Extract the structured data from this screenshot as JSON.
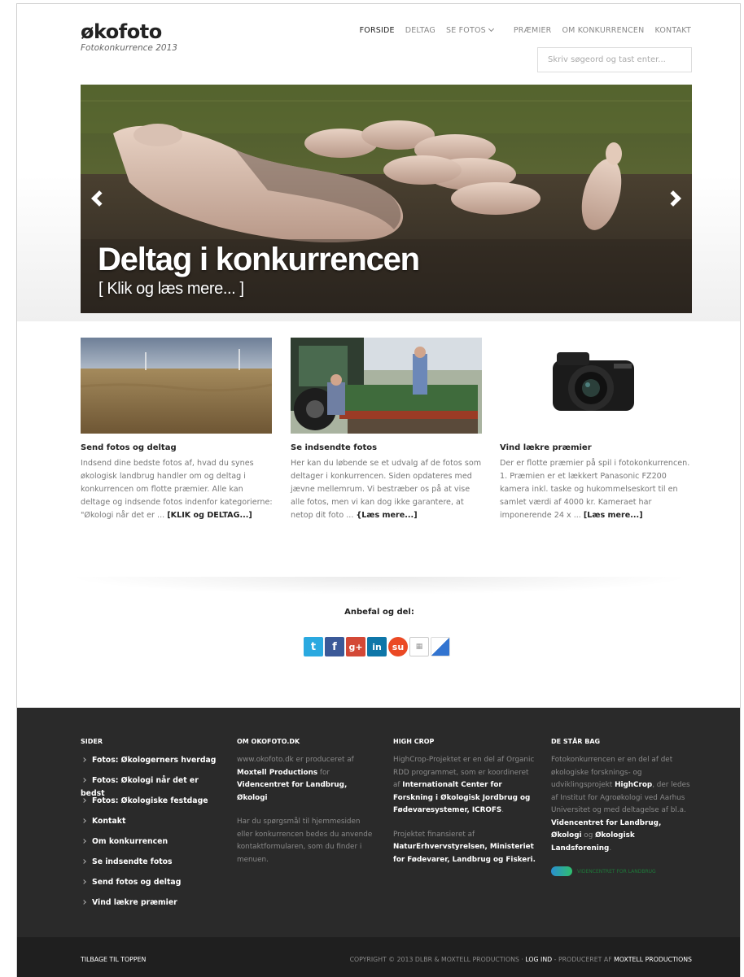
{
  "header": {
    "logo": "økofoto",
    "tagline": "Fotokonkurrence 2013",
    "nav": [
      "FORSIDE",
      "DELTAG",
      "SE FOTOS",
      "PRÆMIER",
      "OM KONKURRENCEN",
      "KONTAKT"
    ],
    "search_placeholder": "Skriv søgeord og tast enter..."
  },
  "hero": {
    "title": "Deltag i konkurrencen",
    "subtitle": "[ Klik og læs mere... ]"
  },
  "features": [
    {
      "title": "Send fotos og deltag",
      "text": "Indsend dine bedste fotos af, hvad du synes økologisk landbrug handler om og deltag i konkurrencen om flotte præmier. Alle kan deltage og indsende fotos indenfor kategorierne: \"Økologi når det er ...",
      "more": "[KLIK og DELTAG...]"
    },
    {
      "title": "Se indsendte fotos",
      "text": "Her kan du løbende se et udvalg af de fotos som deltager i konkurrencen. Siden opdateres med jævne mellemrum. Vi bestræber os på at vise alle fotos, men vi kan  dog ikke garantere, at netop dit foto ...",
      "more": "{Læs mere...]"
    },
    {
      "title": "Vind lækre præmier",
      "text": "Der er flotte præmier på spil i fotokonkurrencen. 1. Præmien er et lækkert Panasonic FZ200 kamera inkl. taske og hukommelseskort til en samlet værdi af 4000 kr. Kameraet har imponerende 24 x ...",
      "more": "[Læs mere...]"
    }
  ],
  "share": {
    "title": "Anbefal og del:",
    "icons": [
      "twitter-icon",
      "facebook-icon",
      "google-plus-icon",
      "linkedin-icon",
      "stumbleupon-icon",
      "digg-icon",
      "delicious-icon"
    ]
  },
  "footer": {
    "sider": {
      "title": "SIDER",
      "items": [
        "Fotos: Økologerners hverdag",
        "Fotos: Økologi når det er bedst",
        "Fotos: Økologiske festdage",
        "Kontakt",
        "Om konkurrencen",
        "Se indsendte fotos",
        "Send fotos og deltag",
        "Vind lækre præmier"
      ]
    },
    "om": {
      "title": "OM OKOFOTO.DK",
      "p1_a": "www.okofoto.dk er produceret af ",
      "p1_b": "Moxtell Productions",
      "p1_c": " for ",
      "p1_d": "Videncentret for Landbrug, Økologi",
      "p2": "Har du spørgsmål til hjemmesiden eller konkurrencen bedes du anvende kontaktformularen, som du finder i menuen."
    },
    "highcrop": {
      "title": "HIGH CROP",
      "p1_a": "HighCrop-Projektet er en del af Organic RDD programmet, som er koordineret af ",
      "p1_b": "Internationalt Center for Forskning i Økologisk Jordbrug og Fødevaresystemer, ICROFS",
      "p1_c": ".",
      "p2_a": "Projektet finansieret af ",
      "p2_b": "NaturErhvervstyrelsen, Ministeriet for Fødevarer, Landbrug og Fiskeri."
    },
    "bag": {
      "title": "DE STÅR BAG",
      "p_a": "Fotokonkurrencen er en del af det økologiske forsknings- og udviklingsprojekt ",
      "p_b": "HighCrop",
      "p_c": ", der ledes af Institut for Agroøkologi ved Aarhus Universitet og med deltagelse af bl.a. ",
      "p_d": "Videncentret for Landbrug, Økologi",
      "p_e": " og ",
      "p_f": "Økologisk Landsforening",
      "p_g": ".",
      "logo_text": "VIDENCENTRET FOR LANDBRUG"
    },
    "bottom_left": "TILBAGE TIL TOPPEN",
    "bottom_right_a": "COPYRIGHT © 2013 DLBR & MOXTELL PRODUCTIONS · ",
    "bottom_right_b": "LOG IND",
    "bottom_right_c": " - PRODUCERET AF ",
    "bottom_right_d": "MOXTELL PRODUCTIONS"
  }
}
